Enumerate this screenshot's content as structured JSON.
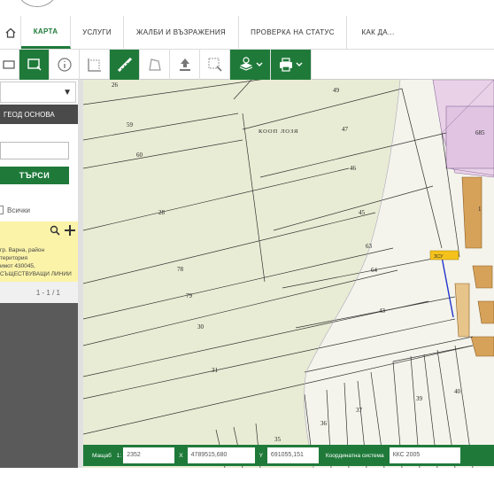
{
  "nav": {
    "tabs": [
      {
        "label": "КАРТА",
        "active": true
      },
      {
        "label": "УСЛУГИ",
        "active": false
      },
      {
        "label": "ЖАЛБИ И ВЪЗРАЖЕНИЯ",
        "active": false
      },
      {
        "label": "ПРОВЕРКА НА СТАТУС",
        "active": false
      },
      {
        "label": "КАК ДА...",
        "active": false
      }
    ]
  },
  "toolbar": {
    "buttons": [
      "select-rect-icon",
      "select-rect-active-icon",
      "info-icon",
      "measure-grid-icon",
      "ruler-icon",
      "polygon-icon",
      "upload-icon",
      "zoom-box-icon",
      "layers-icon",
      "print-icon"
    ]
  },
  "sidebar": {
    "header": "ГЕОД ОСНОВА",
    "search_label": "ТЪРСИ",
    "checkbox_label": "Всички",
    "result_lines": [
      "гр. Варна, район",
      "територия",
      "имот 430045,",
      "СЪЩЕСТВУВАЩИ ЛИНИИ"
    ],
    "pager": "1 - 1 / 1"
  },
  "map": {
    "parcel_labels": [
      "26",
      "49",
      "59",
      "47",
      "60",
      "46",
      "28",
      "45",
      "63",
      "78",
      "64",
      "79",
      "43",
      "30",
      "31",
      "40",
      "39",
      "37",
      "36",
      "35",
      "685",
      "1"
    ],
    "area_label": "КООП ЛОЗЯ",
    "marker": "ЗСУ"
  },
  "status_bar": {
    "scale_label": "Мащаб",
    "scale_prefix": "1:",
    "scale_value": "2352",
    "x_label": "X",
    "x_value": "4789515,680",
    "y_label": "Y",
    "y_value": "691055,151",
    "crs_label": "Координатна система",
    "crs_value": "ККС 2005"
  },
  "colors": {
    "accent": "#1f7a3a",
    "map_green": "#e9ecd4",
    "map_pink": "#e9d2e8",
    "map_orange": "#d6a25a"
  }
}
